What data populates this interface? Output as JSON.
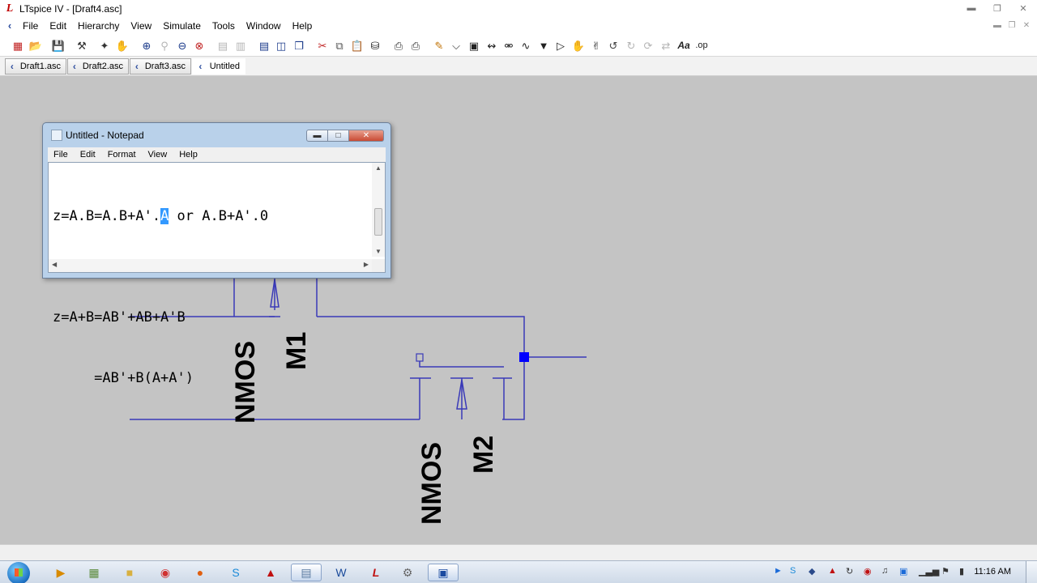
{
  "window": {
    "title": "LTspice IV - [Draft4.asc]",
    "app_icon": "ltspice-logo"
  },
  "menubar": {
    "items": [
      "File",
      "Edit",
      "Hierarchy",
      "View",
      "Simulate",
      "Tools",
      "Window",
      "Help"
    ]
  },
  "toolbar": {
    "icons": [
      "new-schematic-icon",
      "open-icon",
      "save-icon",
      "control-panel-icon",
      "run-icon",
      "halt-icon",
      "pan-icon",
      "zoom-in-icon",
      "zoom-area-icon",
      "zoom-out-icon",
      "zoom-fit-icon",
      "autorange-icon",
      "zoom-back-icon",
      "tile-horizontal-icon",
      "tile-vertical-icon",
      "cascade-icon",
      "cut-icon",
      "copy-icon",
      "paste-icon",
      "find-icon",
      "print-setup-icon",
      "print-icon",
      "wire-icon",
      "ground-icon",
      "label-net-icon",
      "resistor-icon",
      "capacitor-icon",
      "inductor-icon",
      "diode-icon",
      "component-icon",
      "move-icon",
      "drag-icon",
      "undo-icon",
      "redo-icon",
      "rotate-icon",
      "mirror-icon",
      "text-icon",
      "spice-directive-icon"
    ]
  },
  "tabs": [
    {
      "label": "Draft1.asc",
      "active": false
    },
    {
      "label": "Draft2.asc",
      "active": false
    },
    {
      "label": "Draft3.asc",
      "active": false
    },
    {
      "label": "Untitled",
      "active": true
    }
  ],
  "notepad": {
    "title": "Untitled - Notepad",
    "menu": [
      "File",
      "Edit",
      "Format",
      "View",
      "Help"
    ],
    "line1_before": "z=A.B=A.B+A'.",
    "line1_selected": "A",
    "line1_after": " or A.B+A'.0",
    "line2": "",
    "line3": "z=A+B=AB'+AB+A'B",
    "line4": "     =AB'+B(A+A')"
  },
  "schematic": {
    "wire_color": "#3a3ab8",
    "node_color": "#0000ff",
    "components": [
      {
        "type": "NMOS",
        "name": "M1"
      },
      {
        "type": "NMOS",
        "name": "M2"
      }
    ]
  },
  "taskbar": {
    "clock": "11:16 AM",
    "apps": [
      "media-player-icon",
      "explorer-icon",
      "folder-icon",
      "chrome-icon",
      "firefox-icon",
      "skype-icon",
      "acrobat-icon",
      "notepad-icon",
      "word-icon",
      "ltspice-icon",
      "tools-icon",
      "screen-recorder-icon"
    ]
  }
}
